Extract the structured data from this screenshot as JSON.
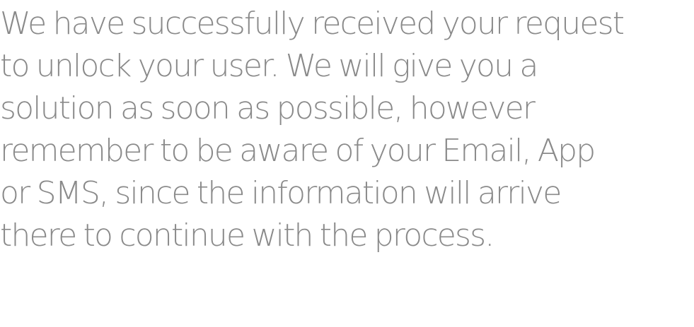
{
  "message": {
    "lines": [
      "We have successfully received your request",
      "to unlock your user. We will give you a",
      "solution as soon as possible, however",
      "remember to be aware of your Email, App",
      "or SMS, since the information will arrive",
      "there to continue with the process."
    ]
  },
  "colors": {
    "text": "#8a8a8a",
    "background": "#ffffff"
  }
}
